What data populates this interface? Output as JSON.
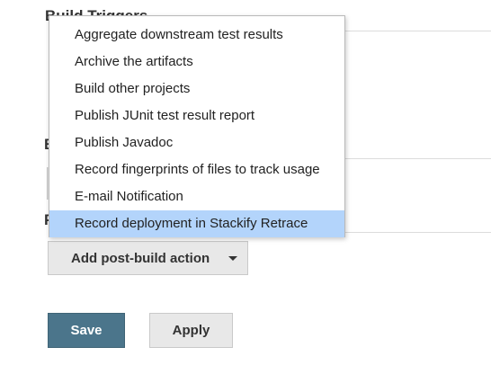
{
  "page": {
    "section_heading": "Build Triggers",
    "partial_letter_1": "B",
    "partial_letter_2": "P"
  },
  "post_build_dropdown": {
    "items": [
      {
        "label": "Aggregate downstream test results"
      },
      {
        "label": "Archive the artifacts"
      },
      {
        "label": "Build other projects"
      },
      {
        "label": "Publish JUnit test result report"
      },
      {
        "label": "Publish Javadoc"
      },
      {
        "label": "Record fingerprints of files to track usage"
      },
      {
        "label": "E-mail Notification"
      },
      {
        "label": "Record deployment in Stackify Retrace"
      }
    ],
    "selected_item": "Record deployment in Stackify Retrace",
    "highlight_color": "#b3d4fb"
  },
  "add_action": {
    "label": "Add post-build action",
    "icon": "caret-down-icon"
  },
  "form_actions": {
    "save_label": "Save",
    "apply_label": "Apply",
    "save_color": "#4b758b"
  }
}
